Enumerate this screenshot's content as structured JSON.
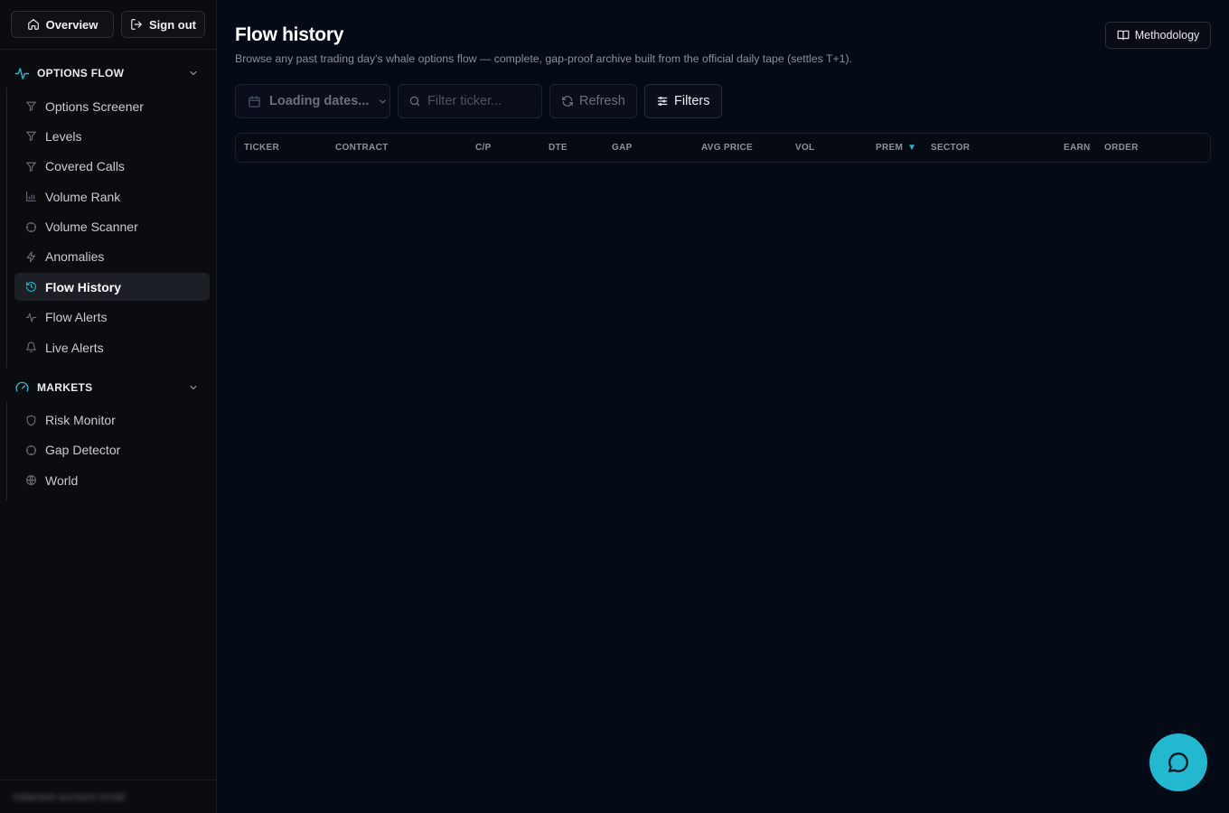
{
  "sidebar": {
    "overview_label": "Overview",
    "signout_label": "Sign out",
    "sections": [
      {
        "title": "OPTIONS FLOW",
        "icon": "activity-icon",
        "items": [
          {
            "label": "Options Screener",
            "icon": "filter-icon"
          },
          {
            "label": "Levels",
            "icon": "filter-icon"
          },
          {
            "label": "Covered Calls",
            "icon": "filter-icon"
          },
          {
            "label": "Volume Rank",
            "icon": "bar-chart-icon"
          },
          {
            "label": "Volume Scanner",
            "icon": "scan-icon"
          },
          {
            "label": "Anomalies",
            "icon": "zap-icon"
          },
          {
            "label": "Flow History",
            "icon": "history-icon",
            "active": true
          },
          {
            "label": "Flow Alerts",
            "icon": "pulse-icon"
          },
          {
            "label": "Live Alerts",
            "icon": "bell-icon"
          }
        ]
      },
      {
        "title": "MARKETS",
        "icon": "gauge-icon",
        "items": [
          {
            "label": "Risk Monitor",
            "icon": "shield-icon"
          },
          {
            "label": "Gap Detector",
            "icon": "scan-icon"
          },
          {
            "label": "World",
            "icon": "globe-icon"
          }
        ]
      }
    ],
    "footer_text": "redacted account email"
  },
  "header": {
    "title": "Flow history",
    "subtitle": "Browse any past trading day's whale options flow — complete, gap-proof archive built from the official daily tape (settles T+1).",
    "methodology_label": "Methodology"
  },
  "toolbar": {
    "date_label": "Loading dates...",
    "search_placeholder": "Filter ticker...",
    "search_value": "",
    "refresh_label": "Refresh",
    "filters_label": "Filters"
  },
  "table": {
    "columns": [
      "TICKER",
      "CONTRACT",
      "C/P",
      "DTE",
      "GAP",
      "AVG PRICE",
      "VOL",
      "PREM",
      "SECTOR",
      "EARN",
      "ORDER"
    ],
    "sorted_column": "PREM",
    "sort_direction": "desc",
    "sort_indicator": "▼",
    "rows": []
  },
  "colors": {
    "accent": "#22b8cf",
    "background": "#050a17",
    "sidebar": "#0b0c0f"
  }
}
